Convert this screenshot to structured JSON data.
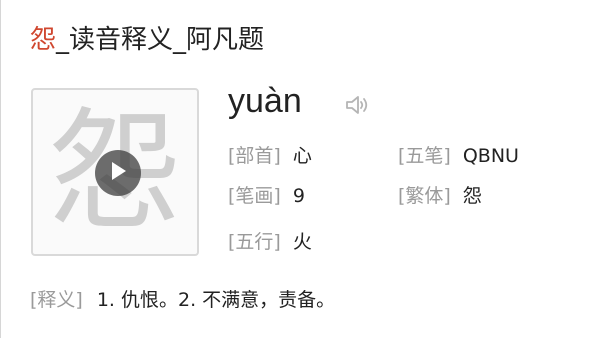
{
  "title": {
    "char": "怨",
    "sep": "_",
    "rest": "读音释义_阿凡题"
  },
  "character": {
    "glyph": "怨",
    "pinyin": "yuàn",
    "play_icon": "play-icon",
    "speaker_icon": "speaker-icon"
  },
  "fields": {
    "bushou": {
      "label": "[部首]",
      "value": "心"
    },
    "wubi": {
      "label": "[五笔]",
      "value": "QBNU"
    },
    "bihua": {
      "label": "[笔画]",
      "value": "9"
    },
    "fanti": {
      "label": "[繁体]",
      "value": "怨"
    },
    "wuxing": {
      "label": "[五行]",
      "value": "火"
    },
    "shiyi": {
      "label": "[释义]",
      "value": "1. 仇恨。2. 不满意，责备。"
    }
  },
  "colors": {
    "title_char": "#d0472f",
    "label": "#9a9a9a",
    "text": "#222222"
  }
}
